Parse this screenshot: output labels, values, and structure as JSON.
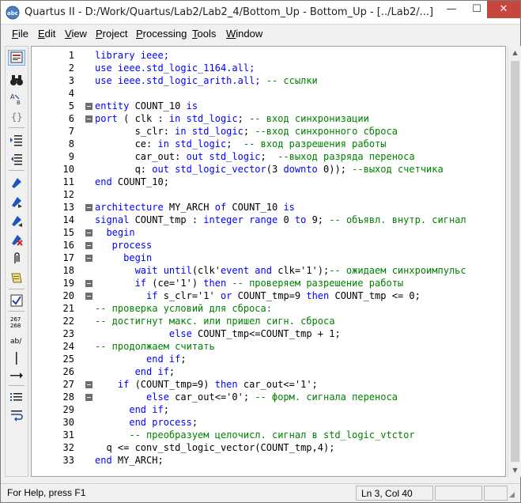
{
  "window": {
    "title": "Quartus II - D:/Work/Quartus/Lab2/Lab2_4/Bottom_Up - Bottom_Up - [../Lab2/...]",
    "min_glyph": "—",
    "max_glyph": "☐",
    "close_glyph": "✕"
  },
  "menu": [
    {
      "label": "File",
      "key": "F",
      "rest": "ile"
    },
    {
      "label": "Edit",
      "key": "E",
      "rest": "dit"
    },
    {
      "label": "View",
      "key": "V",
      "rest": "iew"
    },
    {
      "label": "Project",
      "key": "P",
      "rest": "roject"
    },
    {
      "label": "Processing",
      "key": "P",
      "rest": "rocessing"
    },
    {
      "label": "Tools",
      "key": "T",
      "rest": "ools"
    },
    {
      "label": "Window",
      "key": "W",
      "rest": "indow"
    }
  ],
  "toolbar": {
    "icons": [
      "document-icon",
      "binoculars-icon",
      "find-replace-icon",
      "braces-icon",
      "indent-icon",
      "unindent-icon",
      "bookmark-toggle-icon",
      "bookmark-next-icon",
      "bookmark-prev-icon",
      "bookmark-clear-icon",
      "paperclip-icon",
      "template-icon",
      "check-icon",
      "line-numbers-icon",
      "spell-icon",
      "vertical-bar-icon",
      "arrow-right-icon",
      "list-icon",
      "wrap-icon"
    ],
    "line_numbers_label_top": "267",
    "line_numbers_label_bottom": "268",
    "spell_label": "ab/"
  },
  "editor": {
    "lines": [
      {
        "n": "1",
        "fold": "",
        "parts": [
          [
            "kw",
            "library ieee;"
          ]
        ]
      },
      {
        "n": "2",
        "fold": "",
        "parts": [
          [
            "kw",
            "use ieee.std_logic_1164.all;"
          ]
        ]
      },
      {
        "n": "3",
        "fold": "",
        "parts": [
          [
            "kw",
            "use ieee.std_logic_arith.all; "
          ],
          [
            "cm",
            "-- ссылки"
          ]
        ]
      },
      {
        "n": "4",
        "fold": "",
        "parts": []
      },
      {
        "n": "5",
        "fold": "box",
        "parts": [
          [
            "kw",
            "entity "
          ],
          [
            "nm",
            "COUNT_10 "
          ],
          [
            "kw",
            "is"
          ]
        ]
      },
      {
        "n": "6",
        "fold": "box",
        "parts": [
          [
            "kw",
            "port "
          ],
          [
            "nm",
            "( clk : "
          ],
          [
            "kw",
            "in std_logic"
          ],
          [
            "nm",
            "; "
          ],
          [
            "cm",
            "-- вход синхронизации"
          ]
        ]
      },
      {
        "n": "7",
        "fold": "",
        "parts": [
          [
            "nm",
            "       s_clr: "
          ],
          [
            "kw",
            "in std_logic"
          ],
          [
            "nm",
            "; "
          ],
          [
            "cm",
            "--вход синхронного сброса"
          ]
        ]
      },
      {
        "n": "8",
        "fold": "",
        "parts": [
          [
            "nm",
            "       ce: "
          ],
          [
            "kw",
            "in std_logic"
          ],
          [
            "nm",
            ";  "
          ],
          [
            "cm",
            "-- вход разрешения работы"
          ]
        ]
      },
      {
        "n": "9",
        "fold": "",
        "parts": [
          [
            "nm",
            "       car_out: "
          ],
          [
            "kw",
            "out std_logic"
          ],
          [
            "nm",
            ";  "
          ],
          [
            "cm",
            "--выход разряда переноса"
          ]
        ]
      },
      {
        "n": "10",
        "fold": "",
        "parts": [
          [
            "nm",
            "       q: "
          ],
          [
            "kw",
            "out std_logic_vector"
          ],
          [
            "nm",
            "(3 "
          ],
          [
            "kw",
            "downto "
          ],
          [
            "nm",
            "0)); "
          ],
          [
            "cm",
            "--выход счетчика"
          ]
        ]
      },
      {
        "n": "11",
        "fold": "",
        "parts": [
          [
            "kw",
            "end "
          ],
          [
            "nm",
            "COUNT_10;"
          ]
        ]
      },
      {
        "n": "12",
        "fold": "",
        "parts": []
      },
      {
        "n": "13",
        "fold": "box",
        "parts": [
          [
            "kw",
            "architecture "
          ],
          [
            "nm",
            "MY_ARCH "
          ],
          [
            "kw",
            "of "
          ],
          [
            "nm",
            "COUNT_10 "
          ],
          [
            "kw",
            "is"
          ]
        ]
      },
      {
        "n": "14",
        "fold": "",
        "parts": [
          [
            "kw",
            "signal "
          ],
          [
            "nm",
            "COUNT_tmp : "
          ],
          [
            "kw",
            "integer range "
          ],
          [
            "nm",
            "0 "
          ],
          [
            "kw",
            "to "
          ],
          [
            "nm",
            "9; "
          ],
          [
            "cm",
            "-- объявл. внутр. сигнал"
          ]
        ]
      },
      {
        "n": "15",
        "fold": "box",
        "parts": [
          [
            "kw",
            "  begin"
          ]
        ]
      },
      {
        "n": "16",
        "fold": "box",
        "parts": [
          [
            "kw",
            "   process"
          ]
        ]
      },
      {
        "n": "17",
        "fold": "box",
        "parts": [
          [
            "kw",
            "     begin"
          ]
        ]
      },
      {
        "n": "18",
        "fold": "",
        "parts": [
          [
            "kw",
            "       wait until"
          ],
          [
            "nm",
            "(clk'"
          ],
          [
            "kw",
            "event and "
          ],
          [
            "nm",
            "clk='1');"
          ],
          [
            "cm",
            "-- ожидаем синхроимпульс"
          ]
        ]
      },
      {
        "n": "19",
        "fold": "box",
        "parts": [
          [
            "kw",
            "       if "
          ],
          [
            "nm",
            "(ce='1') "
          ],
          [
            "kw",
            "then "
          ],
          [
            "cm",
            "-- проверяем разрешение работы"
          ]
        ]
      },
      {
        "n": "20",
        "fold": "box",
        "parts": [
          [
            "kw",
            "         if "
          ],
          [
            "nm",
            "s_clr='1' "
          ],
          [
            "kw",
            "or "
          ],
          [
            "nm",
            "COUNT_tmp=9 "
          ],
          [
            "kw",
            "then "
          ],
          [
            "nm",
            "COUNT_tmp <= 0;"
          ]
        ]
      },
      {
        "n": "21",
        "fold": "",
        "parts": [
          [
            "cm",
            "-- проверка условий для сброса:"
          ]
        ]
      },
      {
        "n": "22",
        "fold": "",
        "parts": [
          [
            "cm",
            "-- достигнут макс. или пришел сигн. сброса"
          ]
        ]
      },
      {
        "n": "23",
        "fold": "",
        "parts": [
          [
            "kw",
            "             else "
          ],
          [
            "nm",
            "COUNT_tmp<=COUNT_tmp + 1;"
          ]
        ]
      },
      {
        "n": "24",
        "fold": "",
        "parts": [
          [
            "cm",
            "-- продолжаем считать"
          ]
        ]
      },
      {
        "n": "25",
        "fold": "",
        "parts": [
          [
            "kw",
            "         end if"
          ],
          [
            "nm",
            ";"
          ]
        ]
      },
      {
        "n": "26",
        "fold": "",
        "parts": [
          [
            "kw",
            "       end if"
          ],
          [
            "nm",
            ";"
          ]
        ]
      },
      {
        "n": "27",
        "fold": "box",
        "parts": [
          [
            "kw",
            "    if "
          ],
          [
            "nm",
            "(COUNT_tmp=9) "
          ],
          [
            "kw",
            "then "
          ],
          [
            "nm",
            "car_out<='1';"
          ]
        ]
      },
      {
        "n": "28",
        "fold": "box",
        "parts": [
          [
            "kw",
            "         else "
          ],
          [
            "nm",
            "car_out<='0'; "
          ],
          [
            "cm",
            "-- форм. сигнала переноса"
          ]
        ]
      },
      {
        "n": "29",
        "fold": "",
        "parts": [
          [
            "kw",
            "      end if"
          ],
          [
            "nm",
            ";"
          ]
        ]
      },
      {
        "n": "30",
        "fold": "",
        "parts": [
          [
            "kw",
            "      end process"
          ],
          [
            "nm",
            ";"
          ]
        ]
      },
      {
        "n": "31",
        "fold": "",
        "parts": [
          [
            "cm",
            "      -- преобразуем целочисл. сигнал в std_logic_vtctor"
          ]
        ]
      },
      {
        "n": "32",
        "fold": "",
        "parts": [
          [
            "nm",
            "  q <= conv_std_logic_vector(COUNT_tmp,4);"
          ]
        ]
      },
      {
        "n": "33",
        "fold": "",
        "parts": [
          [
            "kw",
            "end "
          ],
          [
            "nm",
            "MY_ARCH;"
          ]
        ]
      }
    ]
  },
  "statusbar": {
    "help": "For Help, press F1",
    "position": "Ln 3, Col 40"
  }
}
